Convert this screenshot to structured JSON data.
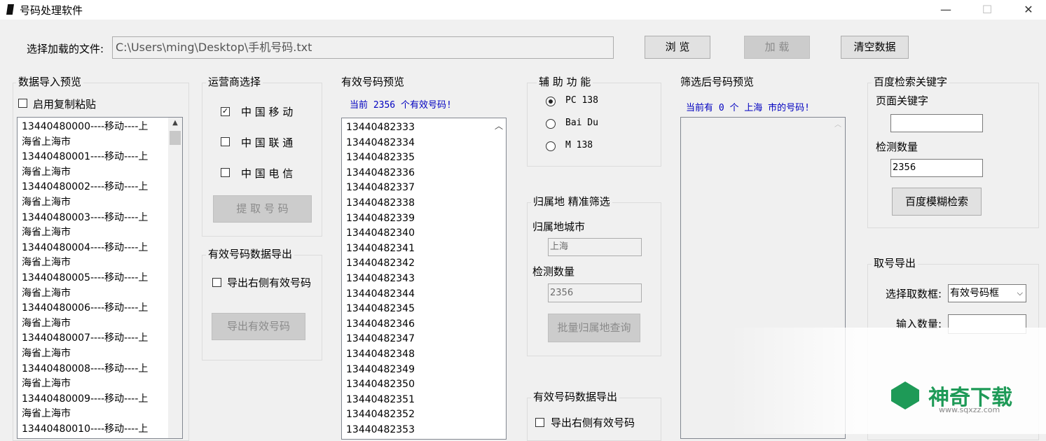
{
  "window": {
    "title": "号码处理软件",
    "minimize": "—",
    "maximize": "☐",
    "close": "✕"
  },
  "file": {
    "label": "选择加载的文件:",
    "path": "C:\\Users\\ming\\Desktop\\手机号码.txt",
    "browse": "浏 览",
    "load": "加 载",
    "clear": "清空数据"
  },
  "import_preview": {
    "legend": "数据导入预览",
    "paste_label": "启用复制粘贴",
    "lines": [
      "13440480000----移动----上",
      "海省上海市",
      "13440480001----移动----上",
      "海省上海市",
      "13440480002----移动----上",
      "海省上海市",
      "13440480003----移动----上",
      "海省上海市",
      "13440480004----移动----上",
      "海省上海市",
      "13440480005----移动----上",
      "海省上海市",
      "13440480006----移动----上",
      "海省上海市",
      "13440480007----移动----上",
      "海省上海市",
      "13440480008----移动----上",
      "海省上海市",
      "13440480009----移动----上",
      "海省上海市",
      "13440480010----移动----上"
    ]
  },
  "carrier": {
    "legend": "运营商选择",
    "mobile": "中 国 移 动",
    "unicom": "中 国 联 通",
    "telecom": "中 国 电 信",
    "extract": "提 取 号 码"
  },
  "export_valid": {
    "legend": "有效号码数据导出",
    "checkbox": "导出右侧有效号码",
    "button": "导出有效号码"
  },
  "valid_preview": {
    "legend": "有效号码预览",
    "status": "当前 2356 个有效号码!",
    "numbers": [
      "13440482333",
      "13440482334",
      "13440482335",
      "13440482336",
      "13440482337",
      "13440482338",
      "13440482339",
      "13440482340",
      "13440482341",
      "13440482342",
      "13440482343",
      "13440482344",
      "13440482345",
      "13440482346",
      "13440482347",
      "13440482348",
      "13440482349",
      "13440482350",
      "13440482351",
      "13440482352",
      "13440482353"
    ]
  },
  "aux": {
    "legend": "辅 助 功 能",
    "opt1": "PC 138",
    "opt2": "Bai Du",
    "opt3": "M 138",
    "selected": "PC 138"
  },
  "location": {
    "legend": "归属地  精准筛选",
    "city_label": "归属地城市",
    "city_value": "上海",
    "count_label": "检测数量",
    "count_value": "2356",
    "button": "批量归属地查询"
  },
  "export_valid2": {
    "legend": "有效号码数据导出",
    "checkbox": "导出右侧有效号码"
  },
  "filtered": {
    "legend": "筛选后号码预览",
    "status": "当前有 0 个 上海 市的号码!"
  },
  "baidu": {
    "legend": "百度检索关键字",
    "keyword_label": "页面关键字",
    "keyword_value": "",
    "count_label": "检测数量",
    "count_value": "2356",
    "button": "百度模糊检索"
  },
  "take": {
    "legend": "取号导出",
    "box_label": "选择取数框:",
    "box_value": "有效号码框",
    "qty_label": "输入数量:",
    "qty_value": ""
  },
  "watermark": {
    "name": "神奇下载",
    "url": "www.sqxzz.com"
  },
  "colors": {
    "status_blue": "#0000c0",
    "watermark_green": "#1e9a57"
  }
}
